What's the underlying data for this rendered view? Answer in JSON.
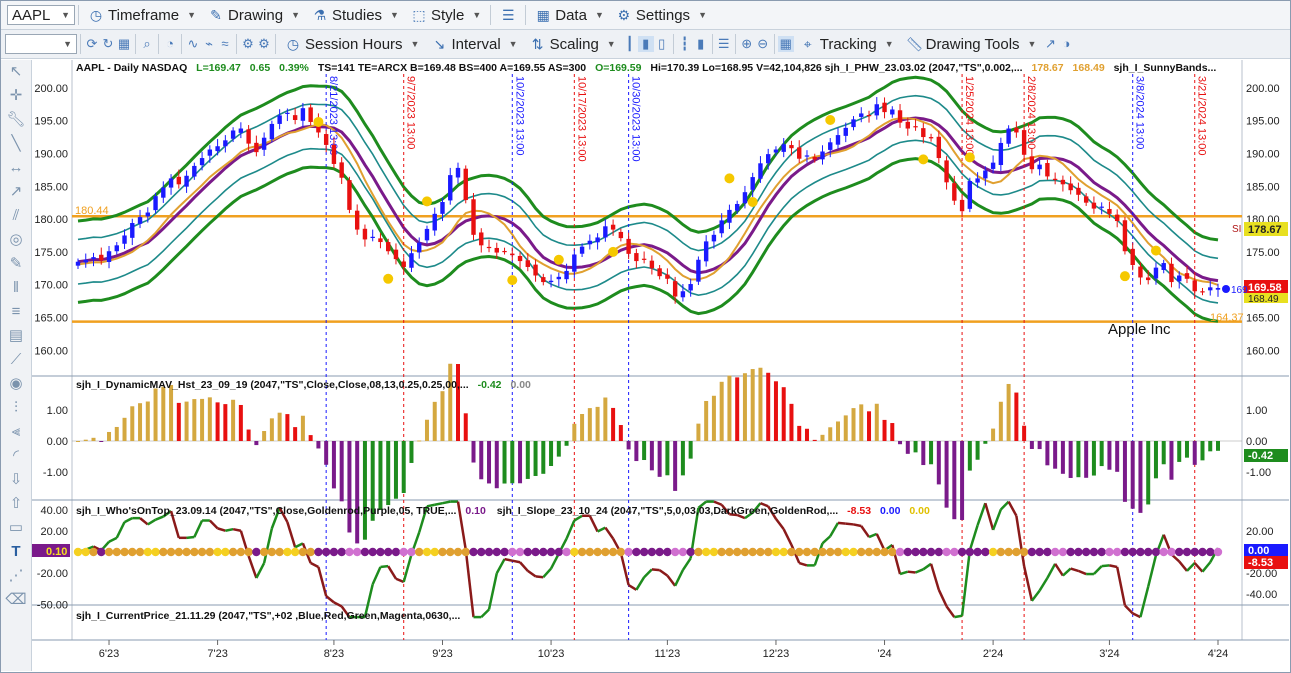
{
  "toolbar1": {
    "symbol": "AAPL",
    "items": [
      "Timeframe",
      "Drawing",
      "Studies",
      "Style",
      "Data",
      "Settings"
    ]
  },
  "toolbar2": {
    "items": [
      "Session Hours",
      "Interval",
      "Scaling",
      "Tracking",
      "Drawing Tools"
    ]
  },
  "header": {
    "sym": "AAPL - Daily  NASDAQ",
    "last": "L=169.47",
    "chg": "0.65",
    "pct": "0.39%",
    "ts": "TS=141  TE=ARCX  B=169.48  BS=400  A=169.55  AS=300",
    "open": "O=169.59",
    "rest": "Hi=170.39  Lo=168.95  V=42,104,826  sjh_I_PHW_23.03.02 (2047,\"TS\",0.002,...",
    "v1": "178.67",
    "v2": "168.49",
    "rest2": "sjh_I_SunnyBands..."
  },
  "panels": {
    "p2_title": "sjh_I_DynamicMAV_Hst_23_09_19 (2047,\"TS\",Close,Close,08,13,0.25,0.25,00,...",
    "p2_v1": "-0.42",
    "p2_v2": "0.00",
    "p3_title_a": "sjh_I_Who'sOnTop_23.09.14 (2047,\"TS\",Close,Goldenrod,Purple,05,  TRUE,...",
    "p3_va": "0.10",
    "p3_title_b": "sjh_I_Slope_23_10_24 (2047,\"TS\",5,0,03,03,DarkGreen,GoldenRod,...",
    "p3_vb1": "-8.53",
    "p3_vb2": "0.00",
    "p3_vb3": "0.00",
    "p4_title": "sjh_I_CurrentPrice_21.11.29 (2047,\"TS\",+02 ,Blue,Red,Green,Magenta,0630,..."
  },
  "annotations": {
    "company": "Apple Inc",
    "hline_top": "180.44",
    "hline_bot": "164.37",
    "si": "SI",
    "right_tag_a": "178.67",
    "right_tag_b": "169.58",
    "right_tag_c": "168.49",
    "p2_tag": "-0.42",
    "p3_tag_a": "0.00",
    "p3_tag_b": "-8.53",
    "p3_left_tag": "0.10",
    "blue_tag": "169"
  },
  "colors": {
    "up": "#1a1aff",
    "down": "#e81010",
    "band": "#1e8c1e",
    "teal": "#1d8a8a",
    "purple": "#7a1a8a",
    "gold": "#e0a030",
    "hline": "#f0a020",
    "dot": "#f5c800"
  },
  "chart_data": {
    "type": "line",
    "title": "AAPL - Daily  NASDAQ",
    "x_labels": [
      "6'23",
      "7'23",
      "8'23",
      "9'23",
      "10'23",
      "11'23",
      "12'23",
      "'24",
      "2'24",
      "3'24",
      "4'24"
    ],
    "y_ticks": [
      200.0,
      195.0,
      190.0,
      185.0,
      180.0,
      175.0,
      170.0,
      165.0,
      160.0
    ],
    "ylim": [
      157.0,
      201.5
    ],
    "price_close": [
      173.5,
      173.8,
      174.2,
      173.7,
      175.1,
      176.0,
      177.5,
      179.4,
      180.3,
      181.0,
      183.5,
      184.8,
      186.2,
      185.3,
      186.6,
      188.1,
      189.3,
      190.6,
      191.1,
      192.0,
      193.5,
      193.8,
      191.5,
      190.2,
      192.4,
      194.5,
      195.8,
      196.2,
      195.1,
      196.9,
      194.8,
      193.2,
      191.3,
      188.4,
      186.3,
      181.4,
      178.4,
      176.9,
      177.3,
      176.5,
      175.1,
      173.9,
      172.7,
      174.8,
      176.4,
      178.5,
      180.8,
      182.6,
      186.7,
      187.8,
      182.9,
      177.6,
      176.0,
      175.6,
      174.9,
      175.1,
      174.5,
      173.6,
      172.7,
      171.4,
      170.4,
      170.6,
      171.2,
      172.1,
      174.6,
      175.8,
      176.7,
      177.2,
      178.9,
      178.4,
      177.1,
      174.7,
      173.6,
      173.9,
      172.5,
      171.3,
      170.9,
      168.2,
      169.0,
      170.1,
      173.8,
      176.6,
      177.6,
      179.8,
      181.4,
      182.3,
      184.1,
      186.4,
      188.5,
      189.9,
      190.6,
      191.4,
      190.8,
      189.2,
      189.7,
      189.1,
      190.3,
      191.7,
      192.8,
      193.9,
      195.2,
      196.1,
      195.8,
      197.5,
      196.3,
      196.7,
      194.7,
      193.8,
      194.1,
      192.5,
      192.3,
      189.3,
      185.6,
      182.8,
      181.2,
      185.8,
      186.2,
      187.4,
      188.6,
      191.6,
      193.8,
      193.2,
      189.8,
      187.6,
      188.3,
      186.5,
      186.1,
      185.3,
      184.4,
      183.7,
      182.5,
      181.6,
      181.9,
      180.8,
      179.7,
      175.1,
      173.0,
      171.1,
      170.7,
      172.6,
      173.3,
      170.4,
      171.4,
      170.9,
      169.0,
      168.9,
      169.6,
      169.5
    ],
    "horizontal_lines": [
      180.44,
      164.37
    ],
    "vertical_markers": [
      "8/21/2023 13:00",
      "9/7/2023 13:00",
      "10/2/2023 13:00",
      "10/17/2023 13:00",
      "10/30/2023 13:00",
      "1/25/2024 13:00",
      "2/8/2024 13:00",
      "3/8/2024 13:00",
      "3/21/2024 13:00"
    ],
    "last_price": 169.58,
    "dynamic_mav_hist": {
      "ylim": [
        -1.8,
        1.6
      ],
      "y_ticks": [
        1.0,
        0.0,
        -1.0
      ],
      "last": -0.42
    },
    "whos_on_top": {
      "ylim": [
        -75,
        60
      ],
      "left_ticks": [
        40.0,
        20.0,
        -20.0,
        -50.0
      ],
      "right_ticks": [
        20.0,
        0.0,
        -20.0,
        -40.0
      ],
      "last_slope": -8.53
    }
  }
}
